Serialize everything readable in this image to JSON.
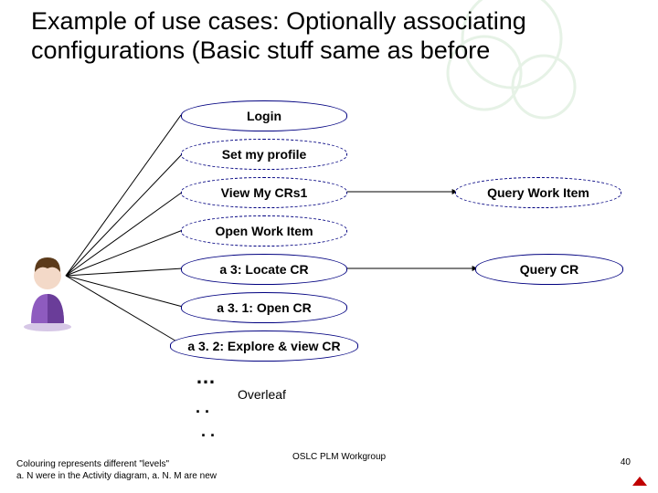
{
  "title": "Example of use cases: Optionally associating configurations (Basic stuff same as before",
  "nodes": {
    "login": "Login",
    "set_profile": "Set my profile",
    "view_crs": "View My CRs1",
    "query_work_item": "Query Work Item",
    "open_work_item": "Open Work Item",
    "a3_locate": "a 3: Locate CR",
    "query_cr": "Query CR",
    "a31_open": "a 3. 1: Open CR",
    "a32_explore": "a 3. 2: Explore & view CR"
  },
  "dots": {
    "d1": "…",
    "d2": ". .",
    "d3": ". ."
  },
  "overleaf": "Overleaf",
  "footnote": "Colouring represents different \"levels\"\na. N were in the Activity diagram, a. N. M are new",
  "footer": "OSLC PLM Workgroup",
  "page": "40"
}
